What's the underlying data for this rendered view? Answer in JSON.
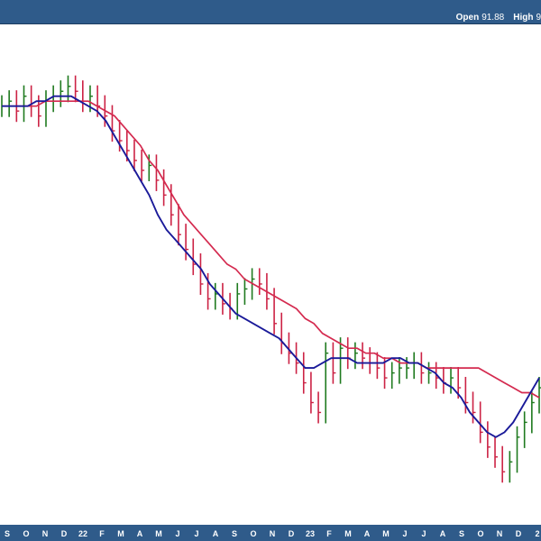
{
  "quote": {
    "open_label": "Open",
    "open_value": "91.88",
    "high_label": "High",
    "high_value": "9"
  },
  "colors": {
    "header": "#2f5b8a",
    "up_bar": "#1f7a1f",
    "down_bar": "#cc2244",
    "ma_short": "#1a1a99",
    "ma_long": "#d42a4f"
  },
  "chart_data": {
    "type": "line",
    "title": "",
    "xlabel": "",
    "ylabel": "",
    "x_axis_labels": [
      "S",
      "O",
      "N",
      "D",
      "22",
      "F",
      "M",
      "A",
      "M",
      "J",
      "J",
      "A",
      "S",
      "O",
      "N",
      "D",
      "23",
      "F",
      "M",
      "A",
      "M",
      "J",
      "J",
      "A",
      "S",
      "O",
      "N",
      "D",
      "2"
    ],
    "grid": false,
    "price_bars": {
      "description_of_visible_levels": "weekly OHLC-style bars; values expressed in relative price units (top of plot = 100, bottom = 0)",
      "weekly_close": [
        84,
        85,
        83,
        86,
        84,
        82,
        85,
        86,
        87,
        88,
        87,
        85,
        86,
        84,
        82,
        79,
        77,
        75,
        73,
        71,
        72,
        69,
        66,
        62,
        58,
        55,
        52,
        48,
        45,
        46,
        44,
        43,
        46,
        47,
        49,
        48,
        45,
        40,
        36,
        34,
        32,
        28,
        24,
        22,
        34,
        30,
        35,
        33,
        34,
        33,
        32,
        31,
        29,
        30,
        31,
        31,
        32,
        30,
        30,
        29,
        28,
        29,
        27,
        24,
        22,
        18,
        15,
        13,
        10,
        12,
        17,
        20,
        24,
        27
      ]
    },
    "series": [
      {
        "name": "",
        "color": "#1a1a99",
        "values": [
          84,
          84,
          84,
          84,
          85,
          85,
          86,
          86,
          86,
          85,
          84,
          83,
          81,
          78,
          75,
          72,
          69,
          66,
          62,
          59,
          57,
          55,
          53,
          51,
          48,
          46,
          44,
          42,
          41,
          40,
          39,
          38,
          37,
          35,
          33,
          31,
          31,
          32,
          33,
          33,
          33,
          32,
          32,
          32,
          32,
          33,
          33,
          32,
          32,
          31,
          30,
          28,
          27,
          25,
          22,
          20,
          18,
          17,
          18,
          20,
          23,
          26,
          29
        ]
      },
      {
        "name": "",
        "color": "#d42a4f",
        "values": [
          84,
          84,
          84,
          84,
          84,
          85,
          85,
          85,
          85,
          85,
          85,
          84,
          83,
          82,
          80,
          78,
          76,
          73,
          71,
          68,
          65,
          62,
          60,
          58,
          56,
          54,
          52,
          51,
          49,
          48,
          47,
          46,
          45,
          44,
          43,
          41,
          40,
          38,
          37,
          36,
          35,
          35,
          34,
          34,
          33,
          33,
          32,
          32,
          32,
          31,
          31,
          31,
          31,
          31,
          31,
          31,
          30,
          29,
          28,
          27,
          26,
          26,
          25
        ]
      }
    ],
    "ylim": [
      0,
      100
    ]
  }
}
